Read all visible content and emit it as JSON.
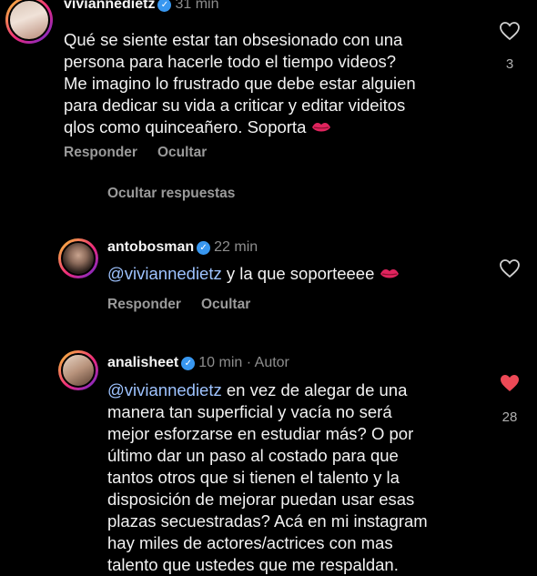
{
  "comments": [
    {
      "username": "viviannedietz",
      "time": "31 min",
      "text": "Qué se siente estar tan obsesionado con una\npersona para hacerle todo el tiempo videos?\nMe imagino lo frustrado que debe estar alguien\npara dedicar su vida a criticar y editar videitos\nqlos como quinceañero. Soporta",
      "emoji": "kiss-mark",
      "reply_label": "Responder",
      "hide_label": "Ocultar",
      "likes": "3",
      "liked": false
    },
    {
      "username": "antobosman",
      "time": "22 min",
      "mention": "@viviannedietz",
      "text": " y la que soporteeee",
      "emoji": "kiss-mark",
      "reply_label": "Responder",
      "hide_label": "Ocultar",
      "liked": false
    },
    {
      "username": "analisheet",
      "time": "10 min",
      "author_label": "· Autor",
      "mention": "@viviannedietz",
      "text_first": " en vez de alegar de una",
      "text": "manera tan superficial y vacía no será\nmejor esforzarse en estudiar más? O por\núltimo dar un paso al costado para que\ntantos otros que si tienen el talento y la\ndisposición de mejorar puedan usar esas\nplazas secuestradas? Acá en mi instagram\nhay miles de actores/actrices con mas\ntalento que ustedes que me respaldan.",
      "likes": "28",
      "liked": true
    }
  ],
  "hide_replies_label": "Ocultar respuestas",
  "colors": {
    "like_active": "#ed4956",
    "verified": "#3897f0",
    "mention": "#9ec3ff"
  }
}
